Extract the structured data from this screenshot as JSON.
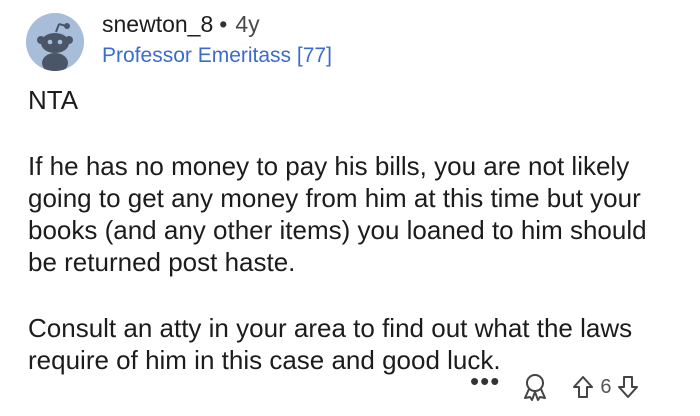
{
  "comment": {
    "author": "snewton_8",
    "separator": "•",
    "age": "4y",
    "flair": "Professor Emeritass [77]",
    "paragraphs": [
      "NTA",
      "If he has no money to pay his bills, you are not likely going to get any money from him at this time but your books (and any other items) you loaned to him should be returned post haste.",
      "Consult an atty in your area to find out what the laws require of him in this case and good luck."
    ]
  },
  "actions": {
    "more_label": "•••",
    "score": "6"
  },
  "icons": {
    "avatar": "snoo-avatar-icon",
    "more": "more-options-icon",
    "award": "award-icon",
    "upvote": "upvote-arrow-icon",
    "downvote": "downvote-arrow-icon"
  },
  "colors": {
    "flair": "#3a6ccc",
    "avatar_bg": "#a7bdd9"
  }
}
